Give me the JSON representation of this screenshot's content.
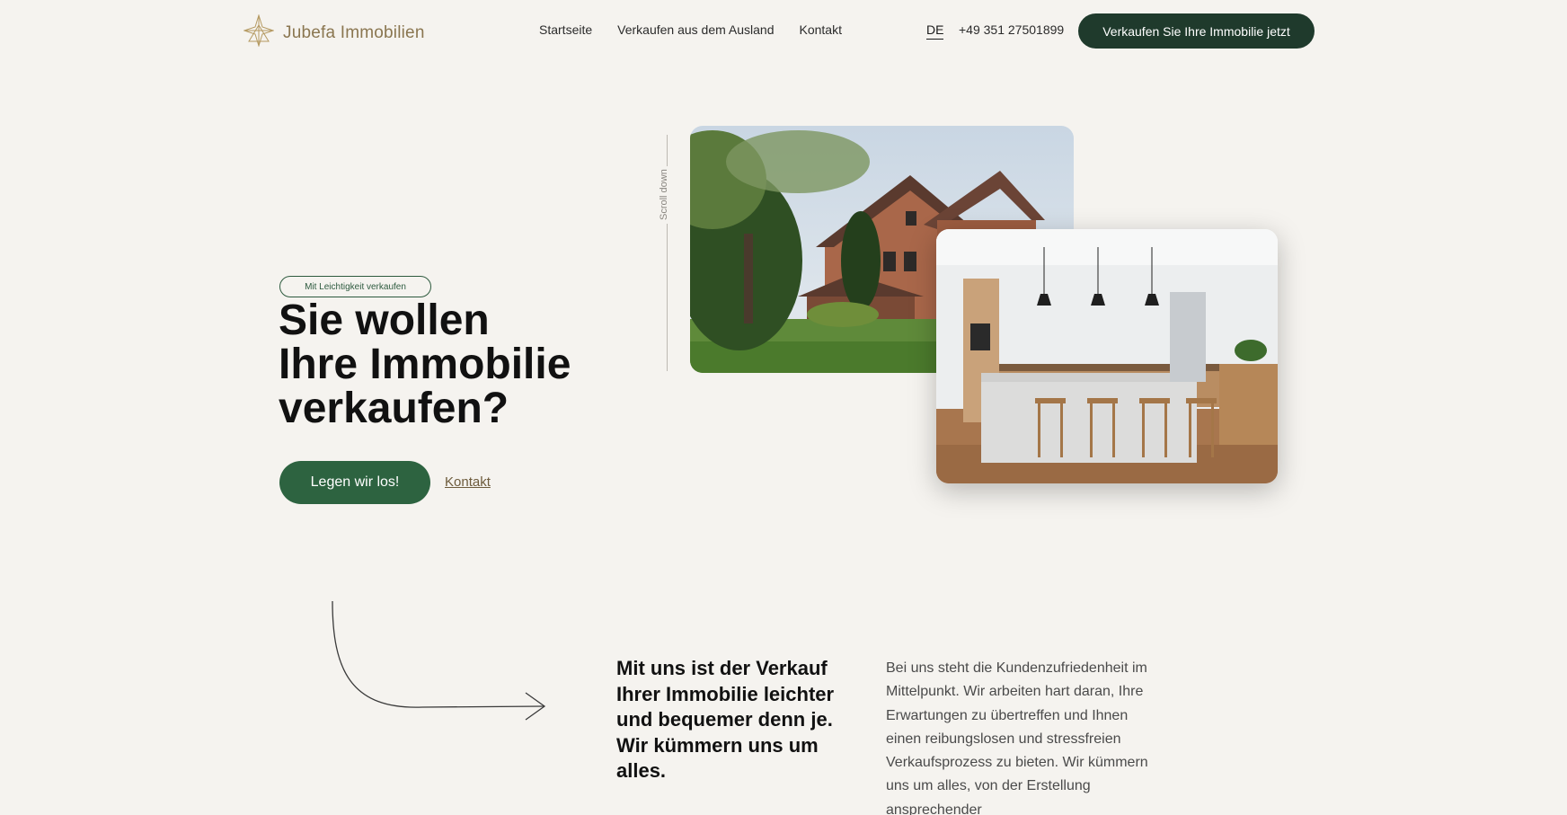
{
  "brand": {
    "name": "Jubefa Immobilien",
    "logo_icon": "star-diamond-icon",
    "color": "#8a7650"
  },
  "nav": {
    "items": [
      {
        "label": "Startseite"
      },
      {
        "label": "Verkaufen aus dem Ausland"
      },
      {
        "label": "Kontakt"
      }
    ],
    "language": "DE",
    "phone": "+49 351 27501899",
    "cta_label": "Verkaufen Sie Ihre Immobilie jetzt"
  },
  "hero": {
    "tag": "Mit Leichtigkeit verkaufen",
    "title_line1": "Sie wollen",
    "title_line2": "Ihre Immobilie",
    "title_line3": "verkaufen?",
    "primary_button": "Legen wir los!",
    "secondary_link": "Kontakt",
    "scroll_hint": "Scroll down"
  },
  "intro": {
    "lead": "Mit uns ist der Verkauf Ihrer Immobilie leichter und bequemer denn je. Wir kümmern uns um alles.",
    "body": "Bei uns steht die Kundenzufriedenheit im Mittelpunkt. Wir arbeiten hart daran, Ihre Erwartungen zu übertreffen und Ihnen einen reibungslosen und stressfreien Verkaufsprozess zu bieten. Wir kümmern uns um alles, von der Erstellung ansprechender"
  },
  "colors": {
    "background": "#f5f3ef",
    "dark_green": "#1f3a2c",
    "accent_green": "#2d6340",
    "gold": "#8a7650"
  }
}
